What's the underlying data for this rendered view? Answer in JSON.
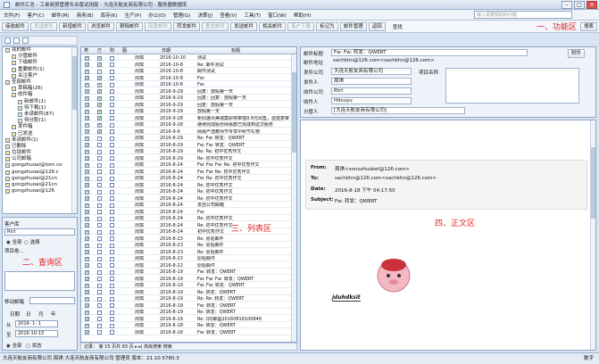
{
  "window": {
    "title": "邮件汇总 - 工单商贸管理专业版试用版 - 大连天航友商有限公司 - 服务器数据库"
  },
  "menu": {
    "items": [
      "文件(F)",
      "客户(C)",
      "邮件(M)",
      "商务(B)",
      "库存(K)",
      "生产(P)",
      "办公(O)",
      "管理(G)",
      "决策(J)",
      "查看(V)",
      "工具(T)",
      "窗口(W)",
      "帮助(H)"
    ],
    "search_placeholder": "输入需要帮助的问题"
  },
  "toolbar": {
    "buttons": [
      "接收邮件",
      "发送邮件",
      "新增邮件",
      "浏览邮件",
      "删除邮件",
      "回复邮件",
      "转发邮件",
      "重发邮件",
      "发送邮件",
      "相关邮件",
      "客户下载",
      "标记为",
      "邮件管理",
      "返回",
      "搜索"
    ],
    "callout": "一、功能区",
    "search_label": "查找"
  },
  "tree": {
    "items": [
      {
        "label": "我的邮件",
        "indent": 0
      },
      {
        "label": "分管邮件",
        "indent": 1
      },
      {
        "label": "下级邮件",
        "indent": 1
      },
      {
        "label": "重要邮件(1)",
        "indent": 1
      },
      {
        "label": "关注客户",
        "indent": 1
      },
      {
        "label": "全部邮件",
        "indent": 0
      },
      {
        "label": "草稿箱(26)",
        "indent": 1
      },
      {
        "label": "收件箱",
        "indent": 1
      },
      {
        "label": "新邮件(1)",
        "indent": 2
      },
      {
        "label": "待下载(1)",
        "indent": 2
      },
      {
        "label": "未读邮件(87)",
        "indent": 2
      },
      {
        "label": "待分配(1)",
        "indent": 2
      },
      {
        "label": "发件箱",
        "indent": 1
      },
      {
        "label": "已发送",
        "indent": 1
      },
      {
        "label": "未读邮件(1)",
        "indent": 0
      },
      {
        "label": "已删除",
        "indent": 0
      },
      {
        "label": "垃圾邮件",
        "indent": 0
      },
      {
        "label": "公司邮箱",
        "indent": 0
      },
      {
        "label": "gongzhuoai@tom.co",
        "indent": 0
      },
      {
        "label": "gongzhuoai@126.c",
        "indent": 0
      },
      {
        "label": "gongzhuoai@21cn",
        "indent": 0
      },
      {
        "label": "gongzhuoai@21cn",
        "indent": 0
      },
      {
        "label": "gongzhuoai@126",
        "indent": 0
      }
    ]
  },
  "query": {
    "customer_label": "客户库",
    "customer_value": "Rtrt",
    "radio_all": "全部",
    "radio_include": "选择",
    "project_label": "项目卷...",
    "callout": "二、查询区",
    "move_label": "移动邮箱",
    "date_label": "日期",
    "date_tabs": [
      "日",
      "月",
      "年"
    ],
    "from_label": "从",
    "from_value": "2016- 1- 1",
    "to_label": "至",
    "to_value": "2016-10-13",
    "bottom_all": "全部",
    "bottom_status": "状态"
  },
  "list": {
    "headers": [
      "类",
      "已",
      "附",
      "图",
      "日期",
      "标题"
    ],
    "callout": "三、列表区",
    "rows": [
      {
        "a": true,
        "b": true,
        "c": false,
        "who": "周琪",
        "date": "2016-10-10",
        "title": "测试"
      },
      {
        "a": true,
        "b": true,
        "c": false,
        "who": "周琪",
        "date": "2016-10-8",
        "title": "Re: 邮件测试"
      },
      {
        "a": true,
        "b": false,
        "c": false,
        "who": "周琪",
        "date": "2016-10-8",
        "title": "邮件测试"
      },
      {
        "a": true,
        "b": true,
        "c": false,
        "who": "周琪",
        "date": "2016-10-8",
        "title": "Fw:"
      },
      {
        "a": true,
        "b": true,
        "c": false,
        "who": "周琪",
        "date": "2016-10-8",
        "title": "Fw:"
      },
      {
        "a": true,
        "b": true,
        "c": false,
        "who": "周琪",
        "date": "2016-9-29",
        "title": "回复：放假第一天"
      },
      {
        "a": true,
        "b": true,
        "c": false,
        "who": "周琪",
        "date": "2016-9-29",
        "title": "回复：回复：放假第一天"
      },
      {
        "a": true,
        "b": true,
        "c": false,
        "who": "周琪",
        "date": "2016-9-29",
        "title": "回复：放假第一天"
      },
      {
        "a": true,
        "b": true,
        "c": false,
        "who": "周琪",
        "date": "2016-9-29",
        "title": "放假第一天"
      },
      {
        "a": true,
        "b": true,
        "c": false,
        "who": "周琪",
        "date": "2016-9-28",
        "title": "新闻速讯美城案即将审理9.9元出售，遗迹复审"
      },
      {
        "a": true,
        "b": true,
        "c": false,
        "who": "周琪",
        "date": "2016-9-28",
        "title": "继续完成股份网易群已完成到这次服务"
      },
      {
        "a": true,
        "b": true,
        "c": false,
        "who": "周琪",
        "date": "2016-9-9",
        "title": "网易严选教师节专享中秋节礼物"
      },
      {
        "a": true,
        "b": false,
        "c": false,
        "who": "周琪",
        "date": "2016-8-29",
        "title": "Re: Fw: 转发：QWERT"
      },
      {
        "a": true,
        "b": false,
        "c": false,
        "who": "周琪",
        "date": "2016-8-29",
        "title": "Fw: Fw: 转发：QWERT"
      },
      {
        "a": true,
        "b": false,
        "c": false,
        "who": "周琪",
        "date": "2016-8-29",
        "title": "Re: Re: 初中优秀作文"
      },
      {
        "a": true,
        "b": false,
        "c": false,
        "who": "周琪",
        "date": "2016-8-29",
        "title": "Re: 初中优秀作文"
      },
      {
        "a": true,
        "b": false,
        "c": false,
        "who": "周琪",
        "date": "2016-8-24",
        "title": "Fw: Fw: Fw: Re: 初中优秀作文"
      },
      {
        "a": true,
        "b": false,
        "c": false,
        "who": "周琪",
        "date": "2016-8-24",
        "title": "Fw: Fw: Re: 初中优秀作文"
      },
      {
        "a": true,
        "b": false,
        "c": false,
        "who": "周琪",
        "date": "2016-8-24",
        "title": "Fw: Re: 初中优秀作文"
      },
      {
        "a": true,
        "b": false,
        "c": false,
        "who": "周琪",
        "date": "2016-8-24",
        "title": "Re: 初中优秀作文"
      },
      {
        "a": true,
        "b": false,
        "c": false,
        "who": "周琪",
        "date": "2016-8-24",
        "title": "Re: 初中优秀作文"
      },
      {
        "a": true,
        "b": false,
        "c": false,
        "who": "周琪",
        "date": "2016-8-24",
        "title": "Re: 初中优秀作文"
      },
      {
        "a": true,
        "b": false,
        "c": false,
        "who": "周琪",
        "date": "2016-8-24",
        "title": "发自公司邮箱"
      },
      {
        "a": true,
        "b": false,
        "c": false,
        "who": "周琪",
        "date": "2016-8-24",
        "title": "Fw:"
      },
      {
        "a": true,
        "b": false,
        "c": false,
        "who": "周琪",
        "date": "2016-8-24",
        "title": "Re: 初中优秀作文"
      },
      {
        "a": true,
        "b": false,
        "c": false,
        "who": "周琪",
        "date": "2016-8-24",
        "title": "Re: 初中优秀作文"
      },
      {
        "a": true,
        "b": false,
        "c": false,
        "who": "周琪",
        "date": "2016-8-24",
        "title": "初中优秀作文"
      },
      {
        "a": true,
        "b": false,
        "c": false,
        "who": "周琪",
        "date": "2016-8-23",
        "title": "Re: 原始邮件"
      },
      {
        "a": true,
        "b": false,
        "c": false,
        "who": "周琪",
        "date": "2016-8-23",
        "title": "Re: 原始邮件"
      },
      {
        "a": true,
        "b": false,
        "c": false,
        "who": "周琪",
        "date": "2016-8-23",
        "title": "Re: 原始邮件"
      },
      {
        "a": true,
        "b": false,
        "c": false,
        "who": "周琪",
        "date": "2016-8-23",
        "title": "原始邮件"
      },
      {
        "a": true,
        "b": false,
        "c": false,
        "who": "周琪",
        "date": "2016-8-22",
        "title": "原始邮件"
      },
      {
        "a": true,
        "b": false,
        "c": false,
        "who": "周琪",
        "date": "2016-8-19",
        "title": "Fw: 转发：QWERT"
      },
      {
        "a": true,
        "b": false,
        "c": false,
        "who": "周琪",
        "date": "2016-8-19",
        "title": "Fw: Fw: Fw: 转发：QWERT"
      },
      {
        "a": true,
        "b": false,
        "c": false,
        "who": "周琪",
        "date": "2016-8-19",
        "title": "Fw: Fw: 转发：QWERT"
      },
      {
        "a": true,
        "b": false,
        "c": false,
        "who": "周琪",
        "date": "2016-8-19",
        "title": "Re: 转发：QWERT"
      },
      {
        "a": true,
        "b": false,
        "c": false,
        "who": "周琪",
        "date": "2016-8-19",
        "title": "Re: Re: 转发：QWERT"
      },
      {
        "a": true,
        "b": false,
        "c": false,
        "who": "周琪",
        "date": "2016-8-19",
        "title": "Fw: 转发：QWERT"
      },
      {
        "a": true,
        "b": false,
        "c": false,
        "who": "周琪",
        "date": "2016-8-19",
        "title": "Re: 转发：QWERT"
      },
      {
        "a": true,
        "b": false,
        "c": false,
        "who": "周琪",
        "date": "2016-8-19",
        "title": "Re: QQ邮图20160816100846"
      },
      {
        "a": true,
        "b": false,
        "c": false,
        "who": "周琪",
        "date": "2016-8-18",
        "title": "Re: 转发：QWERT"
      },
      {
        "a": true,
        "b": false,
        "c": false,
        "who": "周琪",
        "date": "2016-8-18",
        "title": "Fw: 转发：QWERT"
      }
    ],
    "status": "记录：  第 15 页共 83 页  ▸  ▸|  高级搜索  搜索"
  },
  "header": {
    "subject_label": "邮件标题",
    "subject_value": "Fw: Fw: 转发：QWERT",
    "address_label": "邮件地址",
    "address_value": "sachkhn@126.com<sachkhn@126.com>",
    "sender_company_label": "发件公司",
    "sender_company_value": "大连天航友商有限公司",
    "project_label": "项目名称",
    "sender_label": "发件人",
    "sender_value": "周琪",
    "recv_company_label": "收件公司",
    "recv_company_value": "Rtrt",
    "receiver_label": "收件人",
    "receiver_value": "Hdsuyu",
    "assign_label": "分管人",
    "assign_value": "[大连天航友商有限公司]",
    "attach_button": "附件"
  },
  "mail": {
    "from_label": "From:",
    "from_value": "周琪<sonozhuokel@126.com>",
    "to_label": "To:",
    "to_value": "sachkhn@126.com<sachkhn@126.com>",
    "date_label": "Date:",
    "date_value": "2016-8-18 下午 04:17:50",
    "subject_label": "Subject:",
    "subject_value": "Fw: 转发：QWERT",
    "callout": "四、正文区",
    "signature": "jduhdksit"
  },
  "statusbar": {
    "text": "大连天航友商有限公司  周琪  大连天航友商有限公司  管理员  版本：21.10.5780.3",
    "right": "数字"
  }
}
